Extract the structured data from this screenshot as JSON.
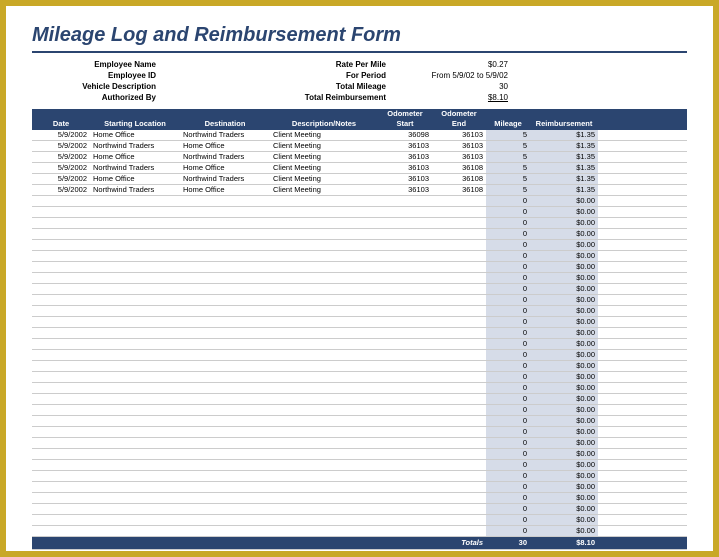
{
  "title": "Mileage Log and Reimbursement Form",
  "header": {
    "left": [
      {
        "label": "Employee Name"
      },
      {
        "label": "Employee ID"
      },
      {
        "label": "Vehicle Description"
      },
      {
        "label": "Authorized By"
      }
    ],
    "right": [
      {
        "label": "Rate Per Mile",
        "value": "$0.27"
      },
      {
        "label": "For Period",
        "value": "From 5/9/02 to 5/9/02"
      },
      {
        "label": "Total Mileage",
        "value": "30"
      },
      {
        "label": "Total Reimbursement",
        "value": "$8.10"
      }
    ]
  },
  "columns": {
    "0": "Date",
    "1": "Starting Location",
    "2": "Destination",
    "3": "Description/Notes",
    "4a": "Odometer",
    "4b": "Start",
    "5a": "Odometer",
    "5b": "End",
    "6": "Mileage",
    "7": "Reimbursement"
  },
  "rows": [
    {
      "date": "5/9/2002",
      "start": "Home Office",
      "dest": "Northwind Traders",
      "desc": "Client Meeting",
      "ostart": "36098",
      "oend": "36103",
      "mileage": "5",
      "reimb": "$1.35"
    },
    {
      "date": "5/9/2002",
      "start": "Northwind Traders",
      "dest": "Home Office",
      "desc": "Client Meeting",
      "ostart": "36103",
      "oend": "36103",
      "mileage": "5",
      "reimb": "$1.35"
    },
    {
      "date": "5/9/2002",
      "start": "Home Office",
      "dest": "Northwind Traders",
      "desc": "Client Meeting",
      "ostart": "36103",
      "oend": "36103",
      "mileage": "5",
      "reimb": "$1.35"
    },
    {
      "date": "5/9/2002",
      "start": "Northwind Traders",
      "dest": "Home Office",
      "desc": "Client Meeting",
      "ostart": "36103",
      "oend": "36108",
      "mileage": "5",
      "reimb": "$1.35"
    },
    {
      "date": "5/9/2002",
      "start": "Home Office",
      "dest": "Northwind Traders",
      "desc": "Client Meeting",
      "ostart": "36103",
      "oend": "36108",
      "mileage": "5",
      "reimb": "$1.35"
    },
    {
      "date": "5/9/2002",
      "start": "Northwind Traders",
      "dest": "Home Office",
      "desc": "Client Meeting",
      "ostart": "36103",
      "oend": "36108",
      "mileage": "5",
      "reimb": "$1.35"
    }
  ],
  "empty_row": {
    "mileage": "0",
    "reimb": "$0.00"
  },
  "empty_count": 31,
  "totals": {
    "label": "Totals",
    "mileage": "30",
    "reimbursement": "$8.10"
  }
}
